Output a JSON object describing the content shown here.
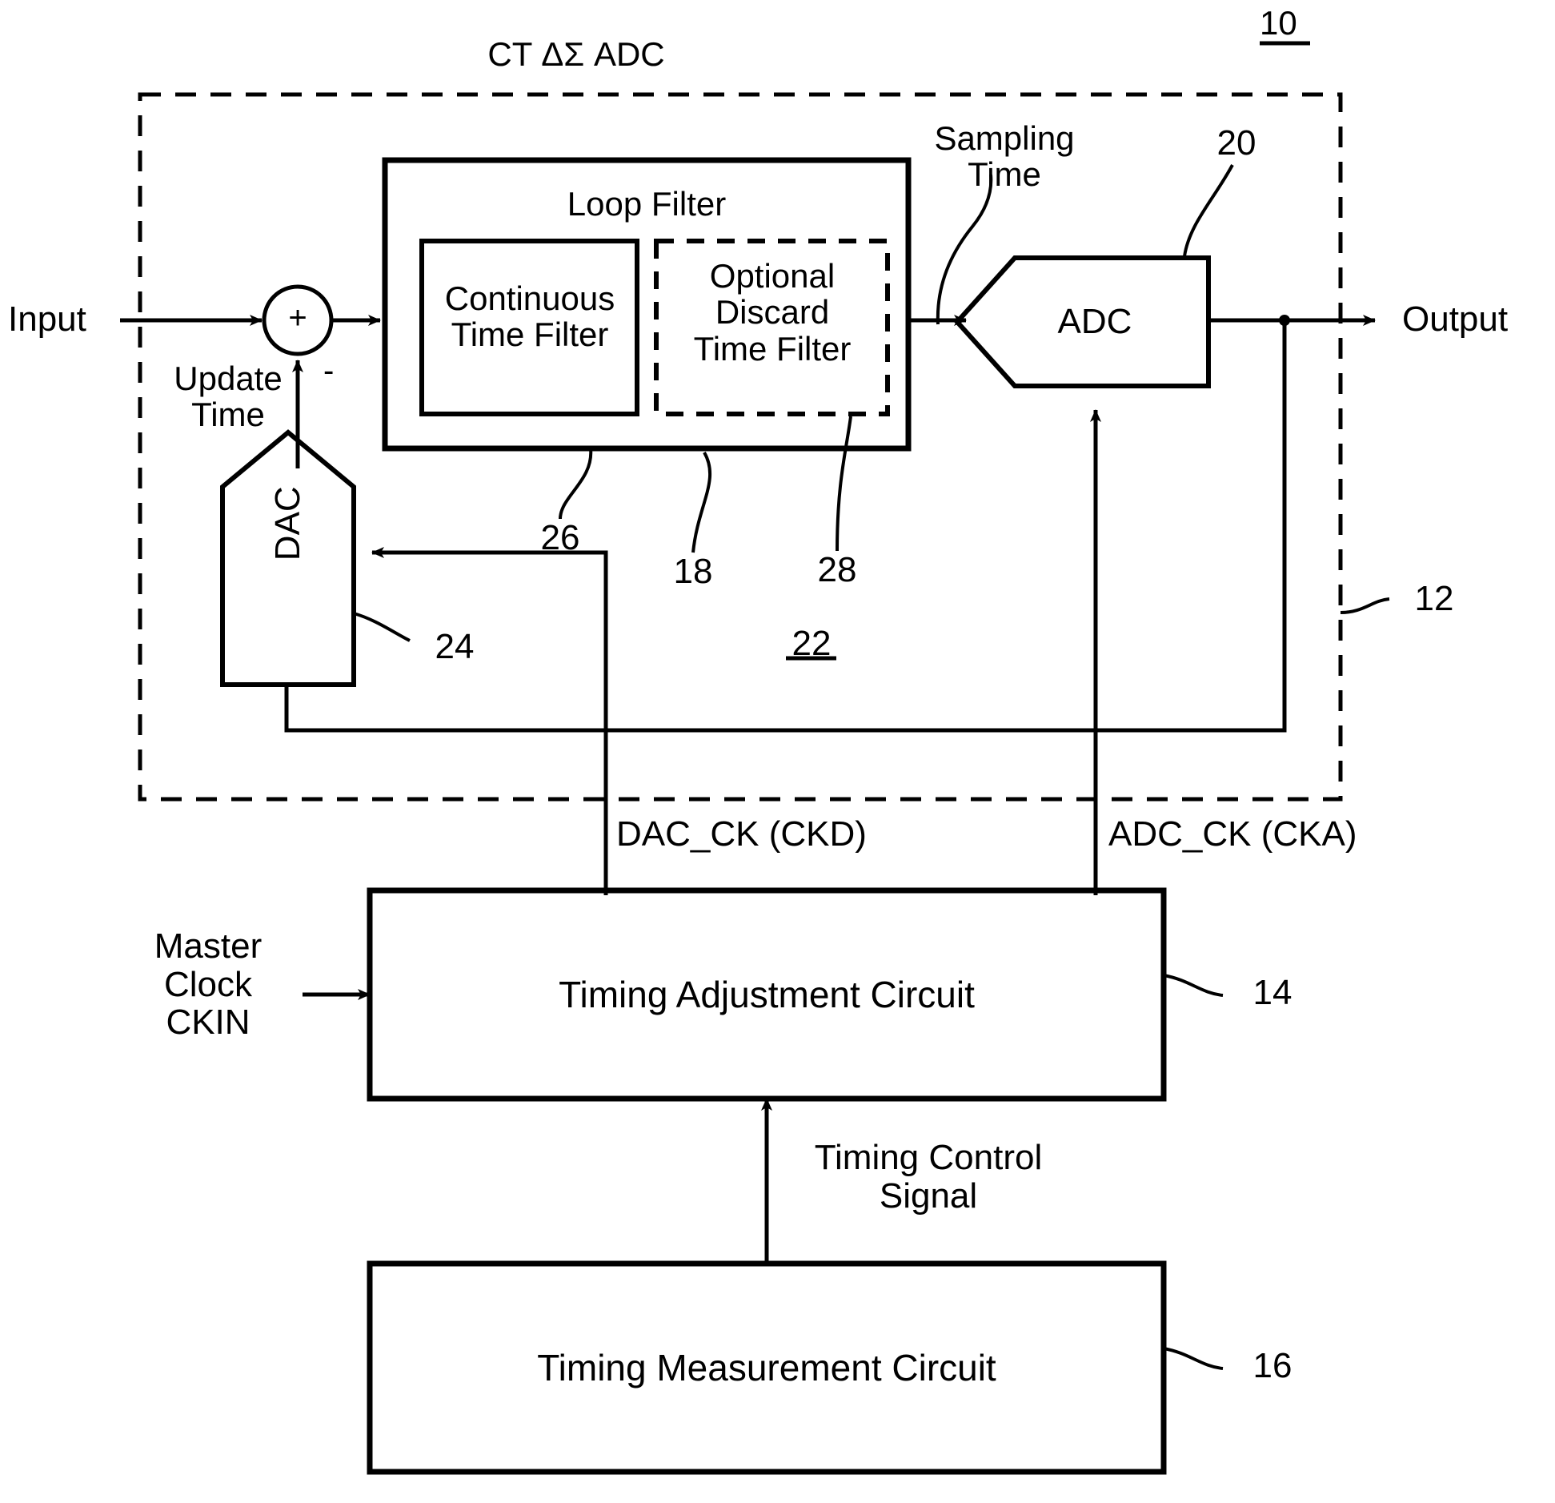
{
  "figure": {
    "title": "CT ΔΣ ADC",
    "top_reference": "10"
  },
  "signals": {
    "input": "Input",
    "output": "Output",
    "update_time": "Update\nTime",
    "sampling_time": "Sampling\nTime",
    "summing_plus": "+",
    "summing_minus": "-",
    "dac_clock": "DAC_CK (CKD)",
    "adc_clock": "ADC_CK (CKA)",
    "master_clock": "Master\nClock\nCKIN",
    "timing_control_signal": "Timing Control\nSignal"
  },
  "blocks": {
    "loop_filter": {
      "label": "Loop Filter",
      "reference": "18",
      "continuous_time_filter": {
        "label": "Continuous\nTime Filter",
        "reference": "26"
      },
      "optional_discard_time_filter": {
        "label": "Optional\nDiscard\nTime Filter",
        "reference": "28"
      }
    },
    "adc": {
      "label": "ADC",
      "reference": "20"
    },
    "dac": {
      "label": "DAC",
      "reference": "24"
    },
    "modulator": {
      "reference": "22"
    },
    "ct_adc_boundary": {
      "reference": "12"
    },
    "timing_adjustment_circuit": {
      "label": "Timing Adjustment Circuit",
      "reference": "14"
    },
    "timing_measurement_circuit": {
      "label": "Timing Measurement Circuit",
      "reference": "16"
    }
  },
  "colors": {
    "ink": "#000000",
    "paper": "#ffffff"
  }
}
